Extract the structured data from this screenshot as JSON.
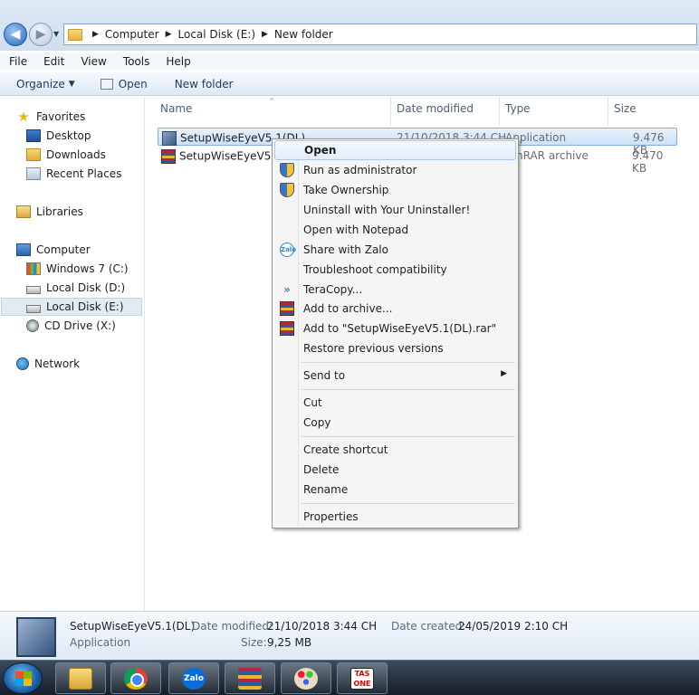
{
  "address": {
    "crumbs": [
      "Computer",
      "Local Disk (E:)",
      "New folder"
    ]
  },
  "menubar": [
    "File",
    "Edit",
    "View",
    "Tools",
    "Help"
  ],
  "toolbar": {
    "organize": "Organize",
    "open": "Open",
    "new_folder": "New folder"
  },
  "nav": {
    "favorites": "Favorites",
    "desktop": "Desktop",
    "downloads": "Downloads",
    "recent": "Recent Places",
    "libraries": "Libraries",
    "computer": "Computer",
    "win7": "Windows 7 (C:)",
    "disk_d": "Local Disk (D:)",
    "disk_e": "Local Disk (E:)",
    "cd": "CD Drive (X:)",
    "network": "Network"
  },
  "columns": {
    "name": "Name",
    "date": "Date modified",
    "type": "Type",
    "size": "Size"
  },
  "files": [
    {
      "name": "SetupWiseEyeV5.1(DL)",
      "date": "21/10/2018 3:44 CH",
      "type": "Application",
      "size": "9.476 KB"
    },
    {
      "name": "SetupWiseEyeV5.1(D",
      "date": "",
      "type": "nRAR archive",
      "size": "9.470 KB"
    }
  ],
  "context_menu": {
    "open": "Open",
    "run_admin": "Run as administrator",
    "take_ownership": "Take Ownership",
    "uninstall": "Uninstall with Your Uninstaller!",
    "notepad": "Open with Notepad",
    "zalo": "Share with Zalo",
    "troubleshoot": "Troubleshoot compatibility",
    "teracopy": "TeraCopy...",
    "add_archive": "Add to archive...",
    "add_rar": "Add to \"SetupWiseEyeV5.1(DL).rar\"",
    "restore": "Restore previous versions",
    "send_to": "Send to",
    "cut": "Cut",
    "copy": "Copy",
    "create_shortcut": "Create shortcut",
    "delete": "Delete",
    "rename": "Rename",
    "properties": "Properties",
    "zalo_icon_text": "Zalo"
  },
  "details": {
    "name": "SetupWiseEyeV5.1(DL)",
    "type": "Application",
    "date_modified_label": "Date modified:",
    "date_modified": "21/10/2018 3:44 CH",
    "date_created_label": "Date created:",
    "date_created": "24/05/2019 2:10 CH",
    "size_label": "Size:",
    "size": "9,25 MB"
  },
  "taskbar": {
    "zalo_label": "Zalo",
    "tas_label": "TAS ONE"
  }
}
